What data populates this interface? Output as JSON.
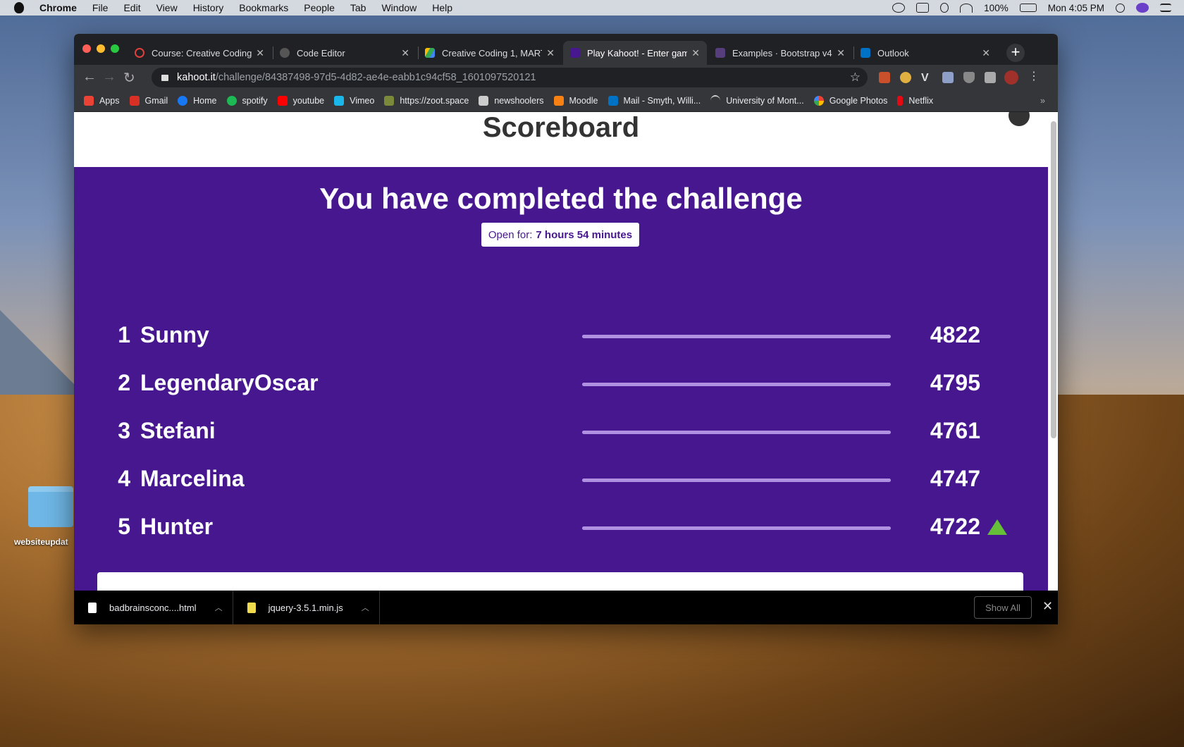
{
  "menubar": {
    "app": "Chrome",
    "menus": [
      "File",
      "Edit",
      "View",
      "History",
      "Bookmarks",
      "People",
      "Tab",
      "Window",
      "Help"
    ],
    "battery": "100%",
    "clock": "Mon 4:05 PM"
  },
  "desktop": {
    "folder_label": "websiteupdat"
  },
  "tabs": [
    {
      "title": "Course: Creative Coding",
      "favicon_color": "#e0403a"
    },
    {
      "title": "Code Editor",
      "favicon_color": "#555555"
    },
    {
      "title": "Creative Coding 1, MART",
      "favicon_color": "#34a853"
    },
    {
      "title": "Play Kahoot! - Enter gam",
      "favicon_color": "#46178f"
    },
    {
      "title": "Examples · Bootstrap v4",
      "favicon_color": "#563d7c"
    },
    {
      "title": "Outlook",
      "favicon_color": "#0072c6"
    }
  ],
  "omnibox": {
    "host": "kahoot.it",
    "path": "/challenge/84387498-97d5-4d82-ae4e-eabb1c94cf58_1601097520121"
  },
  "bookmarks": [
    {
      "label": "Apps",
      "icon": "apps-grid-icon",
      "color": "#ea4335"
    },
    {
      "label": "Gmail",
      "icon": "gmail-icon",
      "color": "#d93025"
    },
    {
      "label": "Home",
      "icon": "facebook-icon",
      "color": "#1877f2"
    },
    {
      "label": "spotify",
      "icon": "spotify-icon",
      "color": "#1db954"
    },
    {
      "label": "youtube",
      "icon": "youtube-icon",
      "color": "#ff0000"
    },
    {
      "label": "Vimeo",
      "icon": "vimeo-icon",
      "color": "#1ab7ea"
    },
    {
      "label": "https://zoot.space",
      "icon": "zoot-icon",
      "color": "#7a8a3a"
    },
    {
      "label": "newshoolers",
      "icon": "newschoolers-icon",
      "color": "#cccccc"
    },
    {
      "label": "Moodle",
      "icon": "moodle-icon",
      "color": "#f98012"
    },
    {
      "label": "Mail - Smyth, Willi...",
      "icon": "outlook-icon",
      "color": "#0072c6"
    },
    {
      "label": "University of Mont...",
      "icon": "umontana-icon",
      "color": "#cccccc"
    },
    {
      "label": "Google Photos",
      "icon": "google-photos-icon",
      "color": "#fbbc04"
    },
    {
      "label": "Netflix",
      "icon": "netflix-icon",
      "color": "#e50914"
    }
  ],
  "page": {
    "title": "Scoreboard",
    "headline": "You have completed the challenge",
    "open_for_label": "Open for:",
    "open_for_value": "7 hours 54 minutes",
    "accent": "#46178f",
    "leaderboard": [
      {
        "rank": "1",
        "name": "Sunny",
        "score": "4822"
      },
      {
        "rank": "2",
        "name": "LegendaryOscar",
        "score": "4795"
      },
      {
        "rank": "3",
        "name": "Stefani",
        "score": "4761"
      },
      {
        "rank": "4",
        "name": "Marcelina",
        "score": "4747"
      },
      {
        "rank": "5",
        "name": "Hunter",
        "score": "4722",
        "trend": "up"
      }
    ]
  },
  "downloads": [
    {
      "name": "badbrainsconc....html"
    },
    {
      "name": "jquery-3.5.1.min.js"
    }
  ],
  "shelf": {
    "show_all": "Show All"
  }
}
